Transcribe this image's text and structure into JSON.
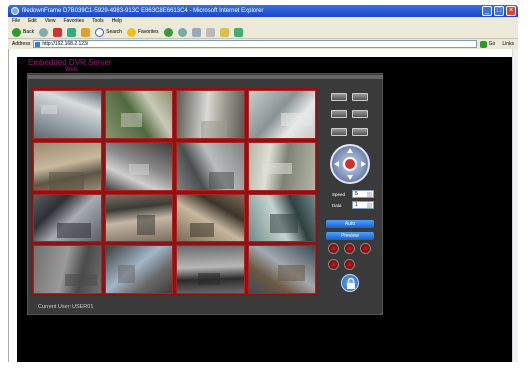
{
  "window": {
    "title": "filedownFrame D7B039C1-5929-4983-913C E863C8E6613C4 - Microsoft Internet Explorer"
  },
  "menu": {
    "items": [
      "File",
      "Edit",
      "View",
      "Favorites",
      "Tools",
      "Help"
    ]
  },
  "toolbar": {
    "back": "Back",
    "search": "Search",
    "favorites": "Favorites"
  },
  "address": {
    "label": "Address",
    "url": "http://192.168.2.123/",
    "go": "Go",
    "links": "Links"
  },
  "app": {
    "title": "Embedded DVR Server",
    "subtitle": "Web",
    "ptz": {
      "speed_label": "Speed",
      "speed_value": "5",
      "data_label": "Data",
      "data_value": "1"
    },
    "buttons": {
      "auto": "Auto",
      "preview": "Preview"
    },
    "current_user_label": "Current User:",
    "current_user": "USER01"
  },
  "cameras": [
    {
      "scene": "parking",
      "colors": [
        "#5b6b72",
        "#a9b2b6",
        "#d8dcdc"
      ]
    },
    {
      "scene": "road",
      "colors": [
        "#8a9270",
        "#4f6a3e",
        "#c9c9b8"
      ]
    },
    {
      "scene": "vans",
      "colors": [
        "#5b5b55",
        "#d9d9d5",
        "#9a9a90"
      ]
    },
    {
      "scene": "room",
      "colors": [
        "#c8cccc",
        "#8a9394",
        "#e8e8e8"
      ]
    },
    {
      "scene": "office",
      "colors": [
        "#9a8a72",
        "#c8b99c",
        "#5c5446"
      ]
    },
    {
      "scene": "corridor",
      "colors": [
        "#3d3d3d",
        "#8a8a8a",
        "#cfcfcf"
      ]
    },
    {
      "scene": "hall",
      "colors": [
        "#7e8282",
        "#b9bdbd",
        "#4a4e4e"
      ]
    },
    {
      "scene": "stairs",
      "colors": [
        "#b3b6a8",
        "#7e8275",
        "#dfe0d5"
      ]
    },
    {
      "scene": "warehouse",
      "colors": [
        "#5a5f66",
        "#a7abb3",
        "#2c2f33"
      ]
    },
    {
      "scene": "corridor2",
      "colors": [
        "#7a6e62",
        "#c4b7a6",
        "#3d3a35"
      ]
    },
    {
      "scene": "counter",
      "colors": [
        "#7d6b55",
        "#c6b79e",
        "#3d352a"
      ]
    },
    {
      "scene": "store",
      "colors": [
        "#6f8a8a",
        "#c5d4d0",
        "#2f4040"
      ]
    },
    {
      "scene": "floor",
      "colors": [
        "#707070",
        "#9a9a9a",
        "#4a4a4a"
      ]
    },
    {
      "scene": "window",
      "colors": [
        "#3c3c3c",
        "#a3b6c8",
        "#6a6a6a"
      ]
    },
    {
      "scene": "lobby",
      "colors": [
        "#6b6b6b",
        "#b8b8b8",
        "#2b2b2b"
      ]
    },
    {
      "scene": "shop",
      "colors": [
        "#3e4a52",
        "#a2a9b0",
        "#6b5a45"
      ]
    }
  ]
}
